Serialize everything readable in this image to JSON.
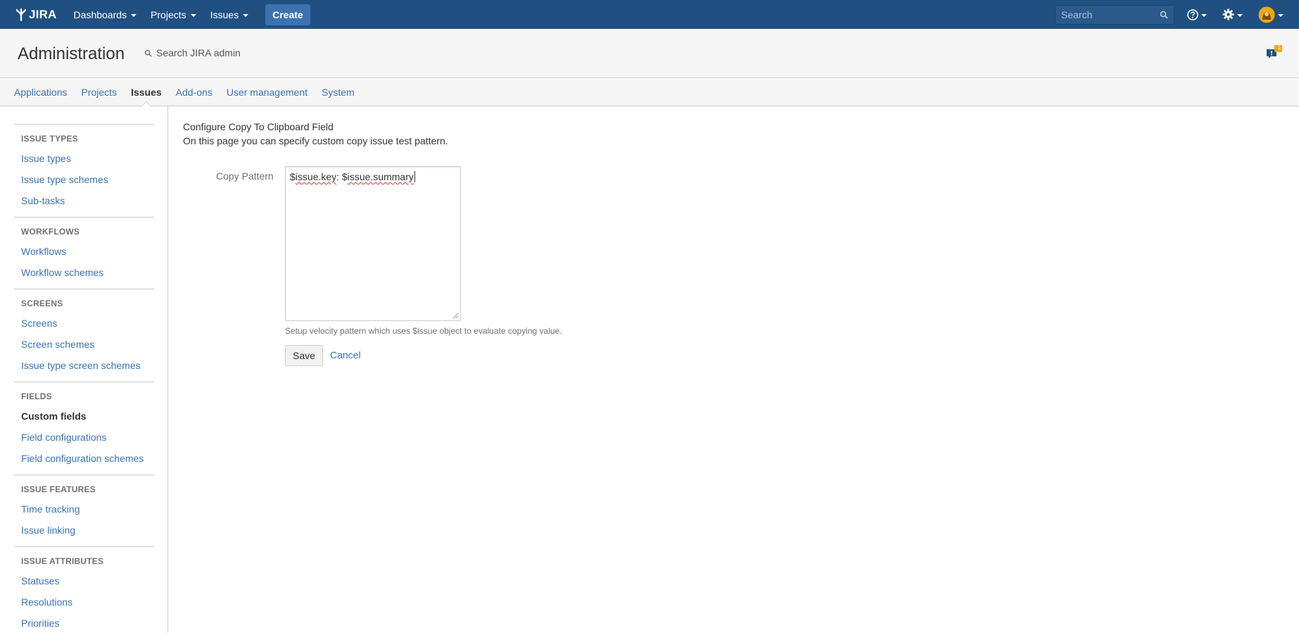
{
  "header": {
    "logo_text": "JIRA",
    "nav": [
      {
        "label": "Dashboards"
      },
      {
        "label": "Projects"
      },
      {
        "label": "Issues"
      }
    ],
    "create_label": "Create",
    "search_placeholder": "Search",
    "notification_count": "1"
  },
  "admin": {
    "title": "Administration",
    "search_label": "Search JIRA admin",
    "tabs": [
      {
        "label": "Applications"
      },
      {
        "label": "Projects"
      },
      {
        "label": "Issues",
        "active": true
      },
      {
        "label": "Add-ons"
      },
      {
        "label": "User management"
      },
      {
        "label": "System"
      }
    ]
  },
  "sidebar": {
    "sections": [
      {
        "heading": "ISSUE TYPES",
        "items": [
          "Issue types",
          "Issue type schemes",
          "Sub-tasks"
        ]
      },
      {
        "heading": "WORKFLOWS",
        "items": [
          "Workflows",
          "Workflow schemes"
        ]
      },
      {
        "heading": "SCREENS",
        "items": [
          "Screens",
          "Screen schemes",
          "Issue type screen schemes"
        ]
      },
      {
        "heading": "FIELDS",
        "items": [
          "Custom fields",
          "Field configurations",
          "Field configuration schemes"
        ]
      },
      {
        "heading": "ISSUE FEATURES",
        "items": [
          "Time tracking",
          "Issue linking"
        ]
      },
      {
        "heading": "ISSUE ATTRIBUTES",
        "items": [
          "Statuses",
          "Resolutions",
          "Priorities"
        ]
      }
    ],
    "active_item": "Custom fields"
  },
  "main": {
    "title": "Configure Copy To Clipboard Field",
    "description": "On this page you can specify custom copy issue test pattern.",
    "field_label": "Copy Pattern",
    "pattern_parts": [
      "$",
      "issue.key",
      ": $",
      "issue.summary"
    ],
    "hint": "Setup velocity pattern which uses $issue object to evaluate copying value.",
    "save_label": "Save",
    "cancel_label": "Cancel"
  },
  "colors": {
    "header_bg": "#205081",
    "link": "#3b73af",
    "create_btn": "#3b73af"
  }
}
